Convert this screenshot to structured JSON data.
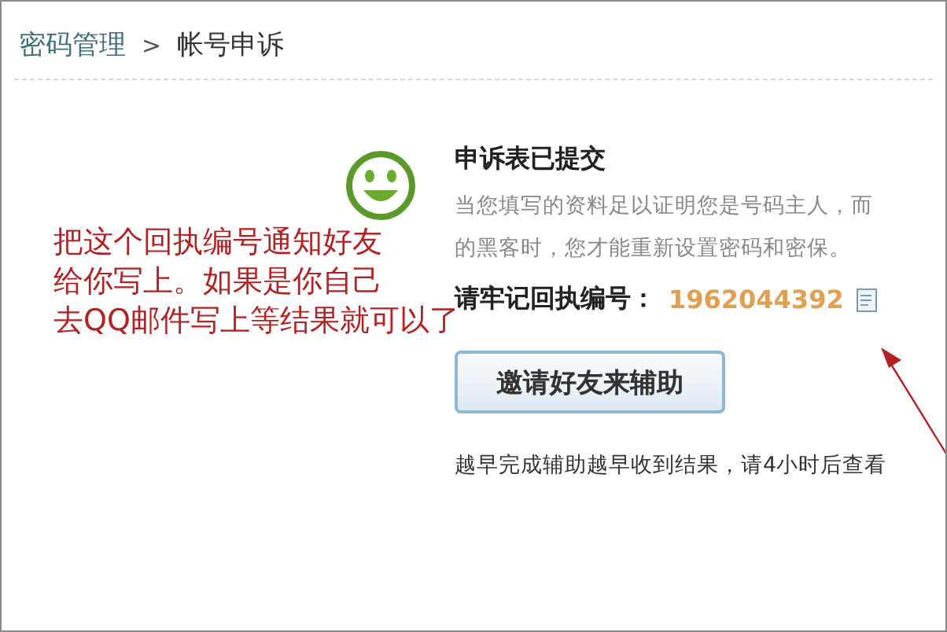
{
  "breadcrumb": {
    "parent": "密码管理",
    "separator": ">",
    "current": "帐号申诉"
  },
  "result": {
    "title": "申诉表已提交",
    "description": [
      "当您填写的资料足以证明您是号码主人，而",
      "的黑客时，您才能重新设置密码和密保。"
    ],
    "receipt_label": "请牢记回执编号：",
    "receipt_number": "1962044392"
  },
  "invite_button": "邀请好友来辅助",
  "note": "越早完成辅助越早收到结果，请4小时后查看",
  "annotation": {
    "lines": [
      "把这个回执编号通知好友",
      "给你写上。如果是你自己",
      "去QQ邮件写上等结果就可以了"
    ],
    "color": "#b22222"
  }
}
